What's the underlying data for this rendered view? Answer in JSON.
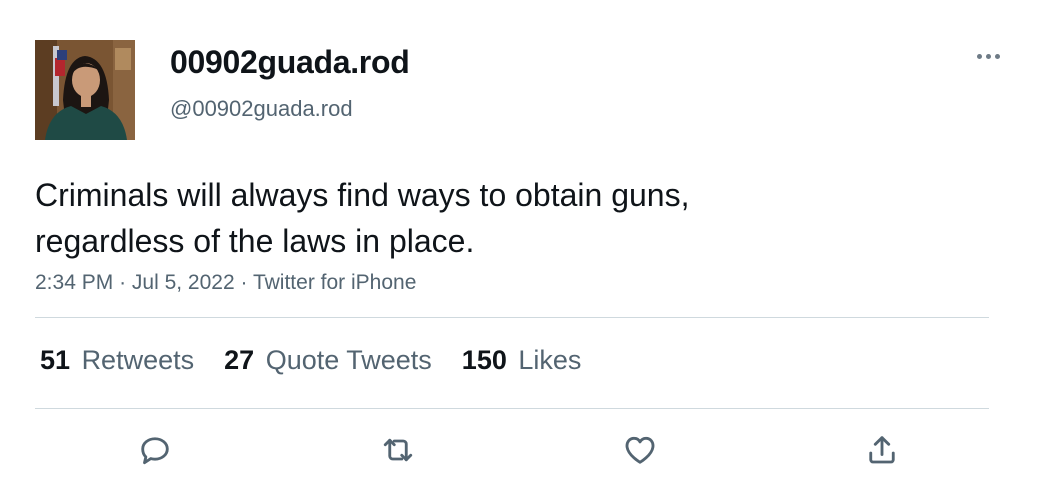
{
  "tweet": {
    "author": {
      "display_name": "00902guada.rod",
      "handle": "@00902guada.rod"
    },
    "text_lines": [
      "Criminals will always find ways to obtain guns,",
      "regardless of the laws in place."
    ],
    "time": "2:34 PM",
    "separator": "·",
    "date": "Jul 5, 2022",
    "source": "Twitter for iPhone",
    "stats": {
      "retweets": {
        "count": "51",
        "label": "Retweets"
      },
      "quote_tweets": {
        "count": "27",
        "label": "Quote Tweets"
      },
      "likes": {
        "count": "150",
        "label": "Likes"
      }
    }
  },
  "icons": {
    "more": "more-horizontal-icon",
    "reply": "reply-icon",
    "retweet": "retweet-icon",
    "like": "heart-icon",
    "share": "share-icon"
  },
  "colors": {
    "text_primary": "#0f1419",
    "text_secondary": "#536471",
    "divider": "#cfd9de"
  }
}
